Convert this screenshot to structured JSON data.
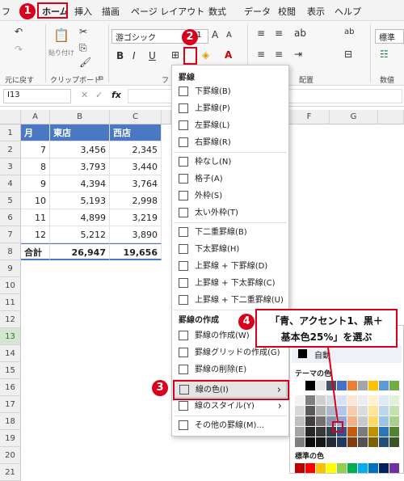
{
  "tabs": [
    "フ",
    "ホーム",
    "挿入",
    "描画",
    "ページ レイアウト",
    "数式",
    "データ",
    "校閲",
    "表示",
    "ヘルプ"
  ],
  "ribbon": {
    "undo_group": "元に戻す",
    "clipboard_group": "クリップボード",
    "paste_label": "貼り付け",
    "font_name": "游ゴシック",
    "font_size": "11",
    "font_group": "フ",
    "align_group": "配置",
    "number_group": "数値",
    "number_format": "標準",
    "bold": "B",
    "italic": "I",
    "underline": "U",
    "grow_font": "A",
    "shrink_font": "A"
  },
  "formula_bar": {
    "name_box": "I13",
    "fx": "fx"
  },
  "columns": [
    "A",
    "B",
    "C",
    "F",
    "G"
  ],
  "rows": [
    "1",
    "2",
    "3",
    "4",
    "5",
    "6",
    "7",
    "8",
    "9",
    "10",
    "11",
    "12",
    "13",
    "14",
    "15",
    "16",
    "17",
    "18",
    "19",
    "20",
    "21"
  ],
  "table": {
    "headers": [
      "月",
      "東店",
      "西店"
    ],
    "data": [
      [
        "7",
        "3,456",
        "2,345"
      ],
      [
        "8",
        "3,793",
        "3,440"
      ],
      [
        "9",
        "4,394",
        "3,764"
      ],
      [
        "10",
        "5,193",
        "2,998"
      ],
      [
        "11",
        "4,899",
        "3,219"
      ],
      [
        "12",
        "5,212",
        "3,890"
      ]
    ],
    "total": [
      "合計",
      "26,947",
      "19,656"
    ]
  },
  "menu": {
    "header1": "罫線",
    "items1": [
      "下罫線(B)",
      "上罫線(P)",
      "左罫線(L)",
      "右罫線(R)",
      "枠なし(N)",
      "格子(A)",
      "外枠(S)",
      "太い外枠(T)",
      "下二重罫線(B)",
      "下太罫線(H)",
      "上罫線 + 下罫線(D)",
      "上罫線 + 下太罫線(C)",
      "上罫線 + 下二重罫線(U)"
    ],
    "header2": "罫線の作成",
    "items2": [
      "罫線の作成(W)",
      "罫線グリッドの作成(G)",
      "罫線の削除(E)",
      "線の色(I)",
      "線のスタイル(Y)",
      "その他の罫線(M)..."
    ]
  },
  "submenu": {
    "auto": "自動",
    "theme_colors": "テーマの色",
    "standard_colors": "標準の色"
  },
  "callout": {
    "line1": "「青、アクセント1、黒＋",
    "line2": "基本色25%」を選ぶ"
  },
  "badges": [
    "1",
    "2",
    "3",
    "4"
  ],
  "colors": {
    "accent_red": "#d9001b",
    "header_blue": "#4a78c2"
  }
}
